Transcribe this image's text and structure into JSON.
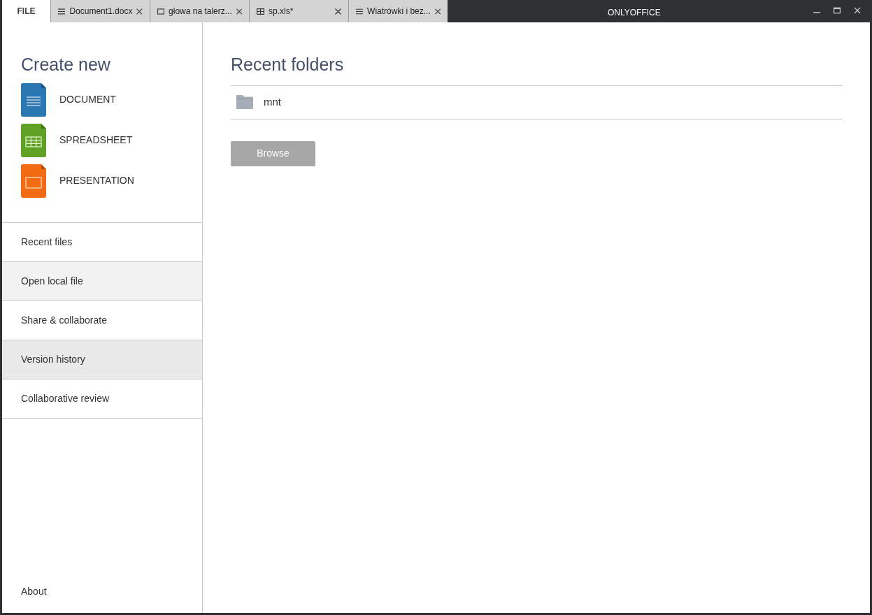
{
  "tabs": [
    {
      "label": "FILE",
      "kind": "file",
      "selected": true
    },
    {
      "label": "Document1.docx",
      "kind": "document",
      "selected": false
    },
    {
      "label": "głowa na talerz...",
      "kind": "presentation",
      "selected": false
    },
    {
      "label": "sp.xls*",
      "kind": "spreadsheet",
      "selected": false
    },
    {
      "label": "Wiatrówki i bez...",
      "kind": "document",
      "selected": false
    }
  ],
  "window": {
    "title": "ONLYOFFICE"
  },
  "create_new": {
    "title": "Create new",
    "items": [
      {
        "label": "DOCUMENT",
        "kind": "document"
      },
      {
        "label": "SPREADSHEET",
        "kind": "spreadsheet"
      },
      {
        "label": "PRESENTATION",
        "kind": "presentation"
      }
    ]
  },
  "sidebar": {
    "items": [
      {
        "label": "Recent files",
        "selected": false,
        "hovered": false
      },
      {
        "label": "Open local file",
        "selected": false,
        "hovered": true
      },
      {
        "label": "Share & collaborate",
        "selected": false,
        "hovered": false
      },
      {
        "label": "Version history",
        "selected": true,
        "hovered": false
      },
      {
        "label": "Collaborative review",
        "selected": false,
        "hovered": false
      }
    ],
    "about": "About"
  },
  "recent_folders": {
    "title": "Recent folders",
    "items": [
      "mnt"
    ],
    "button": "Browse"
  }
}
